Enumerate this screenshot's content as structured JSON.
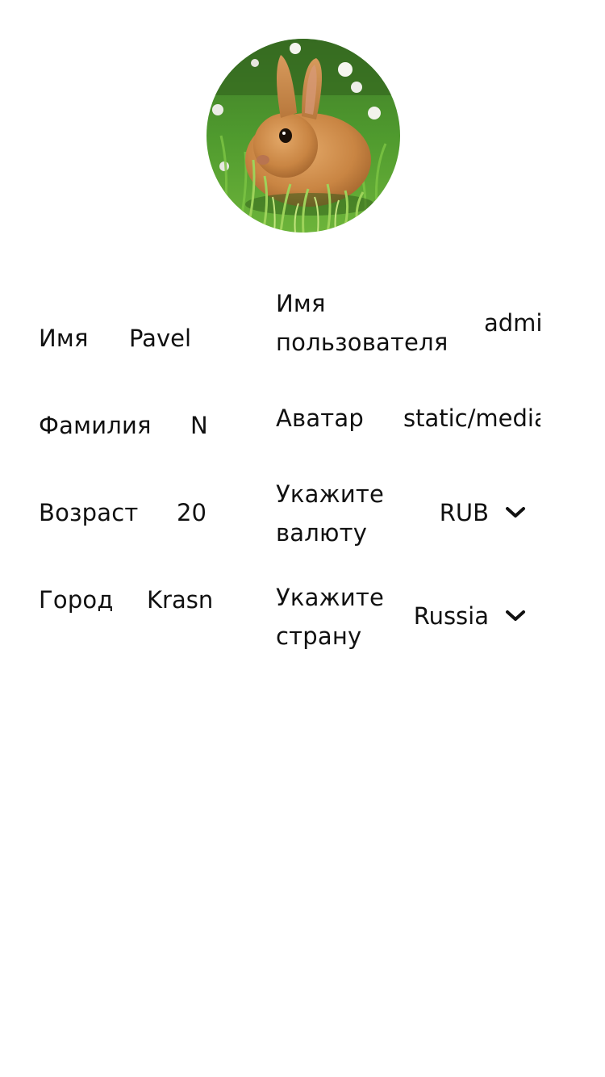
{
  "avatar": {
    "alt": "rabbit-avatar"
  },
  "form": {
    "left": {
      "first_name": {
        "label": "Имя",
        "value": "Pavel"
      },
      "last_name": {
        "label": "Фамилия",
        "value": "N"
      },
      "age": {
        "label": "Возраст",
        "value": "20"
      },
      "city": {
        "label": "Город",
        "value": "Krasn"
      }
    },
    "right": {
      "username": {
        "label_line1": "Имя",
        "label_line2": "пользователя",
        "value": "admi"
      },
      "avatar": {
        "label": "Аватар",
        "value": "static/media"
      },
      "currency": {
        "label_line1": "Укажите",
        "label_line2": "валюту",
        "value": "RUB",
        "icon": "chevron-down-icon"
      },
      "country": {
        "label_line1": "Укажите",
        "label_line2": "страну",
        "value": "Russia",
        "icon": "chevron-down-icon"
      }
    }
  },
  "colors": {
    "text": "#111111",
    "background": "#ffffff"
  }
}
